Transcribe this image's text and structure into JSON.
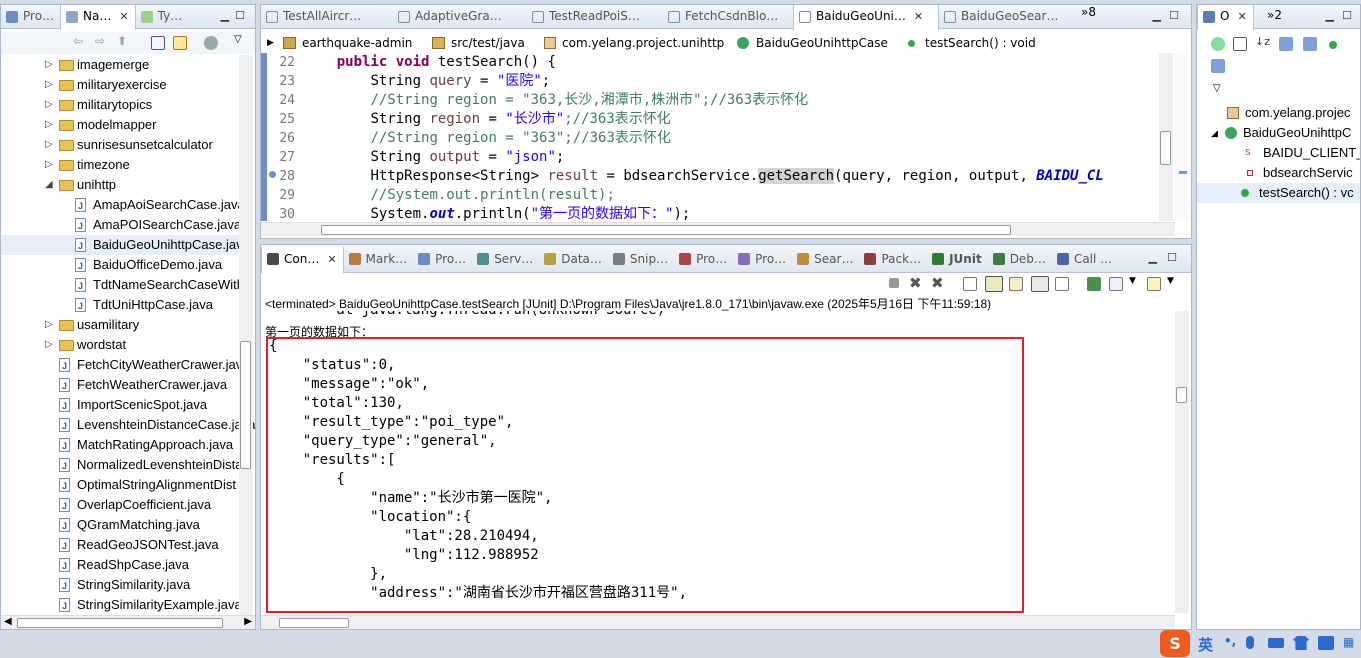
{
  "left_panel": {
    "tabs": [
      {
        "label": "Pro…",
        "active": false
      },
      {
        "label": "Na…",
        "active": true
      },
      {
        "label": "Ty…",
        "active": false
      }
    ],
    "tree": [
      {
        "type": "folder",
        "label": "imagemerge",
        "indent": 1,
        "arrow": "▷"
      },
      {
        "type": "folder",
        "label": "militaryexercise",
        "indent": 1,
        "arrow": "▷"
      },
      {
        "type": "folder",
        "label": "militarytopics",
        "indent": 1,
        "arrow": "▷"
      },
      {
        "type": "folder",
        "label": "modelmapper",
        "indent": 1,
        "arrow": "▷"
      },
      {
        "type": "folder",
        "label": "sunrisesunsetcalculator",
        "indent": 1,
        "arrow": "▷"
      },
      {
        "type": "folder",
        "label": "timezone",
        "indent": 1,
        "arrow": "▷"
      },
      {
        "type": "folder",
        "label": "unihttp",
        "indent": 1,
        "arrow": "◢"
      },
      {
        "type": "file",
        "label": "AmapAoiSearchCase.java",
        "indent": 2
      },
      {
        "type": "file",
        "label": "AmaPOISearchCase.java",
        "indent": 2
      },
      {
        "type": "file",
        "label": "BaiduGeoUnihttpCase.java",
        "indent": 2,
        "selected": true
      },
      {
        "type": "file",
        "label": "BaiduOfficeDemo.java",
        "indent": 2
      },
      {
        "type": "file",
        "label": "TdtNameSearchCaseWith",
        "indent": 2
      },
      {
        "type": "file",
        "label": "TdtUniHttpCase.java",
        "indent": 2
      },
      {
        "type": "folder",
        "label": "usamilitary",
        "indent": 1,
        "arrow": "▷"
      },
      {
        "type": "folder",
        "label": "wordstat",
        "indent": 1,
        "arrow": "▷"
      },
      {
        "type": "file",
        "label": "FetchCityWeatherCrawer.java",
        "indent": 1
      },
      {
        "type": "file",
        "label": "FetchWeatherCrawer.java",
        "indent": 1
      },
      {
        "type": "file",
        "label": "ImportScenicSpot.java",
        "indent": 1
      },
      {
        "type": "file",
        "label": "LevenshteinDistanceCase.java",
        "indent": 1
      },
      {
        "type": "file",
        "label": "MatchRatingApproach.java",
        "indent": 1
      },
      {
        "type": "file",
        "label": "NormalizedLevenshteinDista",
        "indent": 1
      },
      {
        "type": "file",
        "label": "OptimalStringAlignmentDist",
        "indent": 1
      },
      {
        "type": "file",
        "label": "OverlapCoefficient.java",
        "indent": 1
      },
      {
        "type": "file",
        "label": "QGramMatching.java",
        "indent": 1
      },
      {
        "type": "file",
        "label": "ReadGeoJSONTest.java",
        "indent": 1
      },
      {
        "type": "file",
        "label": "ReadShpCase.java",
        "indent": 1
      },
      {
        "type": "file",
        "label": "StringSimilarity.java",
        "indent": 1
      },
      {
        "type": "file",
        "label": "StringSimilarityExample.java",
        "indent": 1
      }
    ]
  },
  "editor": {
    "tabs": [
      {
        "label": "TestAllAircr…",
        "active": false
      },
      {
        "label": "AdaptiveGra…",
        "active": false
      },
      {
        "label": "TestReadPoiS…",
        "active": false
      },
      {
        "label": "FetchCsdnBlo…",
        "active": false
      },
      {
        "label": "BaiduGeoUni…",
        "active": true
      },
      {
        "label": "BaiduGeoSear…",
        "active": false
      }
    ],
    "overflow": "»8",
    "breadcrumb": [
      "earthquake-admin",
      "src/test/java",
      "com.yelang.project.unihttp",
      "BaiduGeoUnihttpCase",
      "testSearch() : void"
    ],
    "line_numbers": [
      "22",
      "23",
      "24",
      "25",
      "26",
      "27",
      "28",
      "29",
      "30"
    ],
    "lines": {
      "l22_kw1": "public",
      "l22_kw2": "void",
      "l22_rest": " testSearch() {",
      "l23_a": "String ",
      "l23_var": "query",
      "l23_b": " = ",
      "l23_str": "\"医院\"",
      "l23_c": ";",
      "l24": "//String region = \"363,长沙,湘潭市,株洲市\";//363表示怀化",
      "l25_a": "String ",
      "l25_var": "region",
      "l25_b": " = ",
      "l25_str": "\"长沙市\"",
      "l25_cm": ";//363表示怀化",
      "l26": "//String region = \"363\";//363表示怀化",
      "l27_a": "String ",
      "l27_var": "output",
      "l27_b": " = ",
      "l27_str": "\"json\"",
      "l27_c": ";",
      "l28_a": "HttpResponse<String> ",
      "l28_var": "result",
      "l28_b": " = bdsearchService.",
      "l28_hl": "getSearch",
      "l28_c": "(query, region, output, ",
      "l28_st": "BAIDU_CL",
      "l29": "//System.out.println(result);",
      "l30_a": "System.",
      "l30_st": "out",
      "l30_b": ".println(",
      "l30_str": "\"第一页的数据如下：\"",
      "l30_c": ");"
    }
  },
  "console": {
    "tabs": [
      {
        "label": "Con…",
        "active": true
      },
      {
        "label": "Mark…"
      },
      {
        "label": "Pro…"
      },
      {
        "label": "Serv…"
      },
      {
        "label": "Data…"
      },
      {
        "label": "Snip…"
      },
      {
        "label": "Pro…"
      },
      {
        "label": "Pro…"
      },
      {
        "label": "Sear…"
      },
      {
        "label": "Pack…"
      },
      {
        "label": "JUnit"
      },
      {
        "label": "Deb…"
      },
      {
        "label": "Call …"
      }
    ],
    "status": "<terminated> BaiduGeoUnihttpCase.testSearch [JUnit] D:\\Program Files\\Java\\jre1.8.0_171\\bin\\javaw.exe (2025年5月16日 下午11:59:18)",
    "lines": [
      "        at java.lang.Thread.run(Unknown Source)",
      "第一页的数据如下：",
      "{",
      "    \"status\":0,",
      "    \"message\":\"ok\",",
      "    \"total\":130,",
      "    \"result_type\":\"poi_type\",",
      "    \"query_type\":\"general\",",
      "    \"results\":[",
      "        {",
      "            \"name\":\"长沙市第一医院\",",
      "            \"location\":{",
      "                \"lat\":28.210494,",
      "                \"lng\":112.988952",
      "            },",
      "            \"address\":\"湖南省长沙市开福区营盘路311号\","
    ]
  },
  "outline": {
    "tabs": [
      {
        "label": "O"
      },
      {
        "label": "»2"
      }
    ],
    "rows": [
      {
        "label": "com.yelang.projec",
        "icon": "package"
      },
      {
        "label": "BaiduGeoUnihttpC",
        "icon": "class"
      },
      {
        "label": "BAIDU_CLIENT_",
        "icon": "sf"
      },
      {
        "label": "bdsearchServic",
        "icon": "field"
      },
      {
        "label": "testSearch() : vc",
        "icon": "method",
        "selected": true
      }
    ]
  },
  "ime": {
    "lang": "英"
  }
}
